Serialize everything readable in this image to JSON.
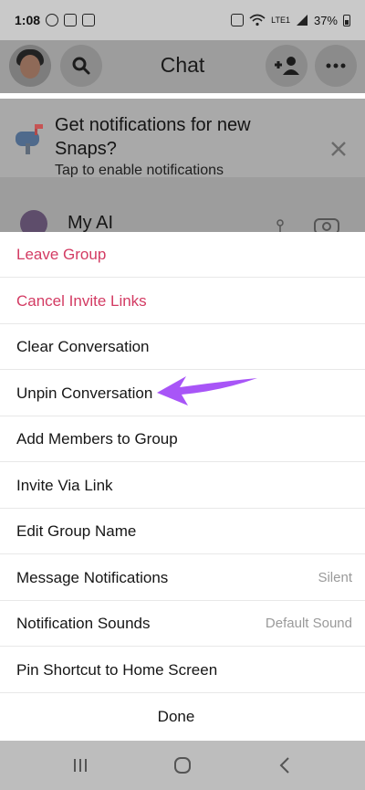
{
  "status_bar": {
    "time": "1:08",
    "network": "LTE1",
    "battery": "37%"
  },
  "header": {
    "title": "Chat",
    "icons": [
      "avatar",
      "search-icon",
      "add-friend-icon",
      "more-icon"
    ]
  },
  "banner": {
    "title": "Get notifications for new Snaps?",
    "subtitle": "Tap to enable notifications",
    "icons": [
      "mailbox-icon",
      "close-icon"
    ]
  },
  "chat_item": {
    "name": "My AI",
    "icons": [
      "pin-icon",
      "camera-icon"
    ]
  },
  "menu": {
    "items": [
      {
        "label": "Leave Group",
        "style": "danger"
      },
      {
        "label": "Cancel Invite Links",
        "style": "danger"
      },
      {
        "label": "Clear Conversation"
      },
      {
        "label": "Unpin Conversation"
      },
      {
        "label": "Add Members to Group"
      },
      {
        "label": "Invite Via Link"
      },
      {
        "label": "Edit Group Name"
      },
      {
        "label": "Message Notifications",
        "value": "Silent"
      },
      {
        "label": "Notification Sounds",
        "value": "Default Sound"
      },
      {
        "label": "Pin Shortcut to Home Screen"
      }
    ],
    "done_label": "Done"
  },
  "colors": {
    "danger": "#d33b63",
    "arrow": "#a855f7",
    "overlay_gray": "#9d9d9d"
  },
  "nav_bar": {
    "icons": [
      "recent-apps-icon",
      "home-icon",
      "back-icon"
    ]
  }
}
